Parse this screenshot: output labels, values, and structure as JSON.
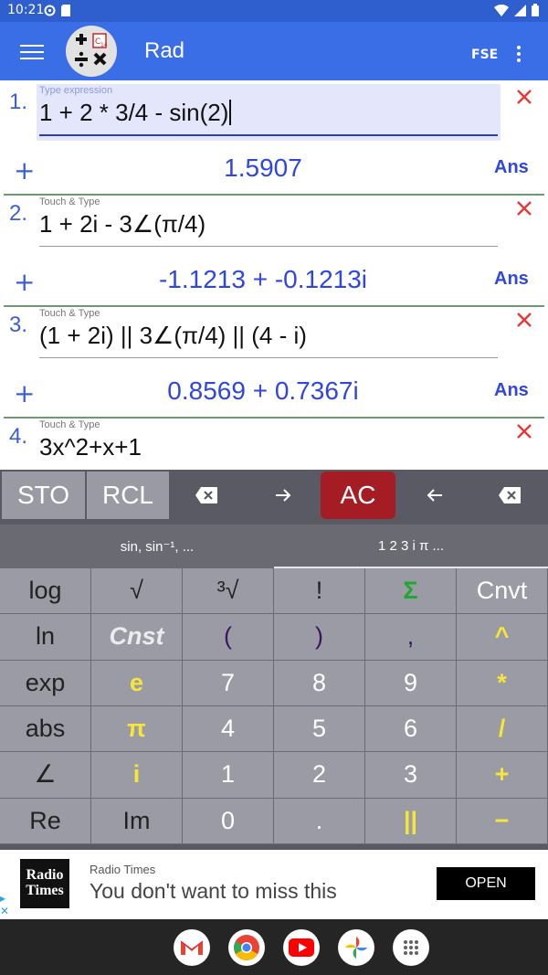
{
  "status": {
    "time": "10:21"
  },
  "appbar": {
    "mode": "Rad",
    "fse_label": "FSE"
  },
  "entries": [
    {
      "number": "1.",
      "hint": "Type expression",
      "expression": "1 + 2 * 3/4 - sin(2)",
      "result": "1.5907",
      "ans_label": "Ans",
      "plus": "+"
    },
    {
      "number": "2.",
      "hint": "Touch & Type",
      "expression": "1 + 2i - 3∠(π/4)",
      "result": "-1.1213 + -0.1213i",
      "ans_label": "Ans",
      "plus": "+"
    },
    {
      "number": "3.",
      "hint": "Touch & Type",
      "expression": "(1 + 2i) || 3∠(π/4) || (4 - i)",
      "result": "0.8569 + 0.7367i",
      "ans_label": "Ans",
      "plus": "+"
    },
    {
      "number": "4.",
      "hint": "Touch & Type",
      "expression": "3x^2+x+1"
    }
  ],
  "toolbar": {
    "sto": "STO",
    "rcl": "RCL",
    "ac": "AC"
  },
  "tabs": {
    "functions": "sin, sin⁻¹, ...",
    "numbers": "1 2 3 i π ..."
  },
  "keypad": {
    "keys": [
      "log",
      "√",
      "³√",
      "!",
      "Σ",
      "Cnvt",
      "ln",
      "Cnst",
      "(",
      ")",
      ",",
      "^",
      "exp",
      "e",
      "7",
      "8",
      "9",
      "*",
      "abs",
      "π",
      "4",
      "5",
      "6",
      "/",
      "∠",
      "i",
      "1",
      "2",
      "3",
      "+",
      "Re",
      "Im",
      "0",
      ".",
      "||",
      "−"
    ]
  },
  "ad": {
    "logo_line1": "Radio",
    "logo_line2": "Times",
    "source": "Radio Times",
    "headline": "You don't want to miss this",
    "cta": "OPEN"
  },
  "colors": {
    "appbar": "#3a6ee6",
    "result": "#2f46e0",
    "ac": "#a51c25",
    "close": "#e53935",
    "yellow_key": "#f5e63a"
  }
}
